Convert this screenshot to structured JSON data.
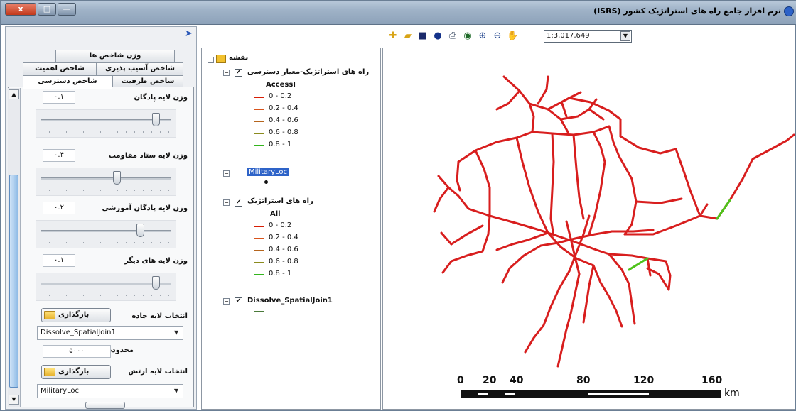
{
  "window": {
    "title": "نرم افزار جامع راه های استراتژیک کشور (ISRS)",
    "close_label": "x",
    "max_label": "□",
    "min_label": "—"
  },
  "left_panel": {
    "tabs": [
      "وزن شاخص ها",
      "شاخص اهمیت",
      "شاخص آسیب پذیری",
      "شاخص ظرفیت",
      "شاخص دسترسی"
    ],
    "active_tab": "شاخص دسترسی",
    "sliders": [
      {
        "label": "وزن لایه پادگان",
        "value": "۰.۱",
        "fraction": 0.88
      },
      {
        "label": "وزن لایه ستاد مقاومت",
        "value": "۰.۴",
        "fraction": 0.58
      },
      {
        "label": "وزن لایه پادگان آموزشی",
        "value": "۰.۲",
        "fraction": 0.76
      },
      {
        "label": "وزن لایه های دیگر",
        "value": "۰.۱",
        "fraction": 0.88
      }
    ],
    "road_layer_label": "انتخاب لایه جاده",
    "load_button_label": "بارگذاری",
    "road_layer_value": "Dissolve_SpatialJoin1",
    "access_range_label": "محدوده دسترسی",
    "access_range_value": "۵۰۰۰",
    "army_layer_label": "انتخاب لایه ارتش",
    "army_load_button_label": "بارگذاری",
    "army_layer_value": "MilitaryLoc"
  },
  "toolbar": {
    "icons": [
      "add-data-icon",
      "open-folder-icon",
      "save-icon",
      "info-icon",
      "print-icon",
      "globe-icon",
      "zoom-in-icon",
      "zoom-out-icon",
      "pan-icon"
    ],
    "scale_value": "1:3,017,649"
  },
  "toc": {
    "root_label": "نقشه",
    "layers": [
      {
        "name": "راه های استراتژیک-معیار دسترسی",
        "checked": true,
        "field": "AccessI",
        "classes": [
          "0 - 0.2",
          "0.2 - 0.4",
          "0.4 - 0.6",
          "0.6 - 0.8",
          "0.8 - 1"
        ]
      },
      {
        "name": "MilitaryLoc",
        "checked": false,
        "selected": true,
        "classes": []
      },
      {
        "name": "راه های استراتژیک",
        "checked": true,
        "field": "All",
        "classes": [
          "0 - 0.2",
          "0.2 - 0.4",
          "0.4 - 0.6",
          "0.6 - 0.8",
          "0.8 - 1"
        ]
      },
      {
        "name": "Dissolve_SpatialJoin1",
        "checked": true,
        "classes": []
      }
    ],
    "class_colors": [
      "#d81e05",
      "#d9541c",
      "#b5651d",
      "#8b8b1e",
      "#33b51d"
    ]
  },
  "map": {
    "road_color": "#d81e1e",
    "highlight_color": "#4ec21a",
    "scale_labels": [
      "0",
      "20",
      "40",
      "80",
      "120",
      "160"
    ],
    "scale_unit": "km"
  }
}
